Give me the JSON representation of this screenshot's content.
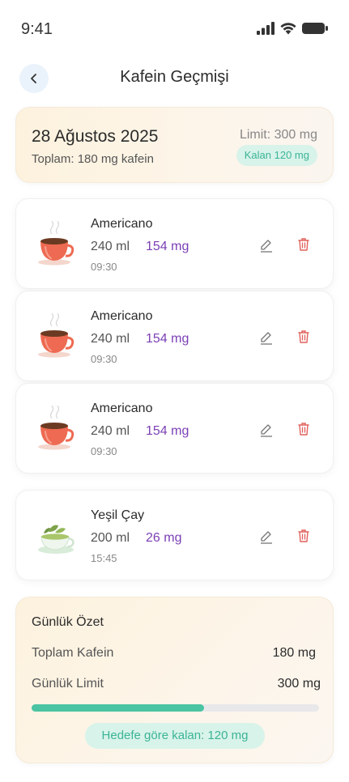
{
  "status_bar": {
    "time": "9:41",
    "icons": [
      "signal-icon",
      "wifi-icon",
      "battery-icon"
    ]
  },
  "header": {
    "back_icon": "chevron-left-icon",
    "title": "Kafein Geçmişi"
  },
  "day": {
    "date": "28 Ağustos 2025",
    "total": "Toplam: 180 mg kafein",
    "limit": "Limit: 300 mg",
    "remaining": "Kalan 120 mg"
  },
  "entries": [
    {
      "name": "Americano",
      "volume": "240 ml",
      "caffeine": "154 mg",
      "time": "09:30",
      "icon": "coffee-cup-icon"
    },
    {
      "name": "Americano",
      "volume": "240 ml",
      "caffeine": "154 mg",
      "time": "09:30",
      "icon": "coffee-cup-icon"
    },
    {
      "name": "Americano",
      "volume": "240 ml",
      "caffeine": "154 mg",
      "time": "09:30",
      "icon": "coffee-cup-icon"
    },
    {
      "name": "Yeşil Çay",
      "volume": "200 ml",
      "caffeine": "26 mg",
      "time": "15:45",
      "icon": "green-tea-cup-icon"
    }
  ],
  "actions": {
    "edit_icon": "pencil-icon",
    "delete_icon": "trash-icon"
  },
  "summary": {
    "title": "Günlük Özet",
    "total_label": "Toplam Kafein",
    "total_value": "180 mg",
    "limit_label": "Günlük Limit",
    "limit_value": "300 mg",
    "progress": 0.6,
    "remaining_badge": "Hedefe göre kalan: 120 mg"
  },
  "colors": {
    "accent_purple": "#7b3fb5",
    "accent_green": "#4ac4a2",
    "delete_red": "#e0605c",
    "card_cream": "#fdf2de"
  }
}
